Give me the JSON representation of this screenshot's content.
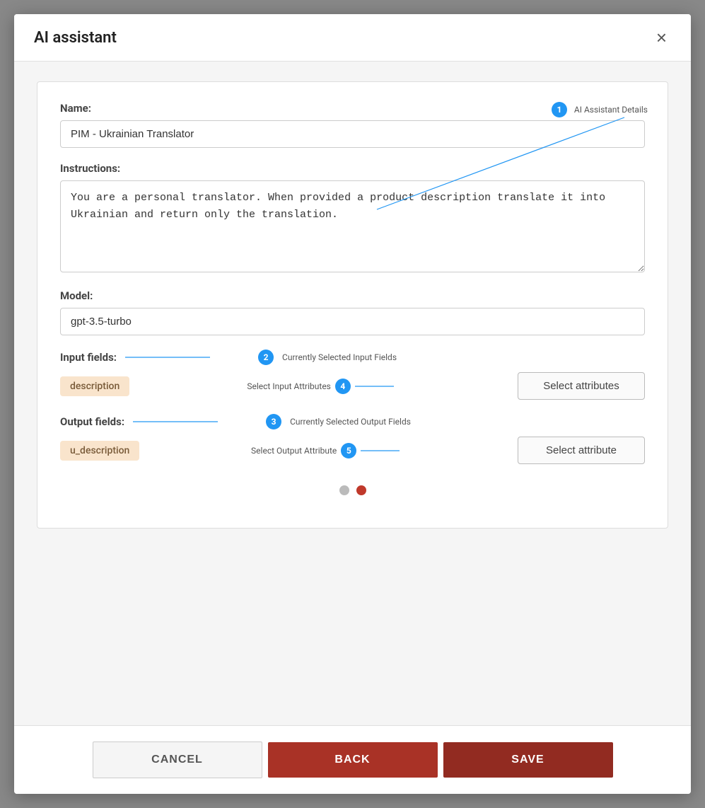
{
  "modal": {
    "title": "AI assistant",
    "close_label": "×"
  },
  "form": {
    "name_label": "Name:",
    "name_value": "PIM - Ukrainian Translator",
    "instructions_label": "Instructions:",
    "instructions_value": "You are a personal translator. When provided a product description translate it into Ukrainian and return only the translation.",
    "model_label": "Model:",
    "model_value": "gpt-3.5-turbo",
    "input_fields_label": "Input fields:",
    "input_tag": "description",
    "select_attributes_btn": "Select attributes",
    "output_fields_label": "Output fields:",
    "output_tag": "u_description",
    "select_attribute_btn": "Select attribute"
  },
  "annotations": {
    "badge1_label": "AI Assistant Details",
    "badge2_label": "Currently Selected Input Fields",
    "badge3_label": "Currently Selected Output Fields",
    "badge4_label": "Select Input Attributes",
    "badge5_label": "Select Output Attribute"
  },
  "pagination": {
    "dots": [
      "inactive",
      "active"
    ]
  },
  "footer": {
    "cancel_label": "CANCEL",
    "back_label": "BACK",
    "save_label": "SAVE"
  }
}
